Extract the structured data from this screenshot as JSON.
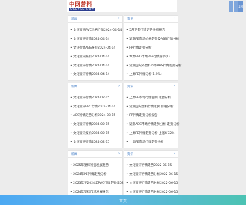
{
  "header": {
    "logo_cn": "中网营料",
    "logo_en": "ULEVLE.COM",
    "btn3_label": "1M"
  },
  "cards": [
    {
      "title": "新闻",
      "more": "›",
      "items": [
        "文化资讯PVC价格行情2024-04-14",
        "文化资讯行情2024-04-14",
        "文化行情ABS报价2024-04-14",
        "文化资讯报价2024-04-14",
        "文化资讯行情2024-04-14",
        "文化资讯行情2024-04-14"
      ]
    },
    {
      "title": "资讯",
      "more": "›",
      "items": [
        "5月下旬行情走势分析报告",
        "近期PE市场价格走势及ABS行情分析",
        "PP行情走势分析",
        "本周PVC市场PTA行情分析(1)",
        "近期国内外塑料市场ABS行情走势分析",
        "上周PE行情分析(1.2%)"
      ]
    },
    {
      "title": "新闻",
      "more": "›",
      "items": [
        "文化资讯行情2024-02-15",
        "文化资讯PVC行情2024-04-14",
        "ABS行情走势分析2024-03-15",
        "文化资讯行情2024-02-15",
        "文化资讯报价2024-02-15",
        "文化资讯行情2024-02-15"
      ]
    },
    {
      "title": "资讯",
      "more": "›",
      "items": [
        "上周PE市场行情回顾 走势分析",
        "近期国内塑料行情走势 价格分析",
        "PP行情走势分析报告",
        "近期ABS市场行情走势分析 走势分析",
        "上周PE行情走势分析 上涨4.72%",
        "上周PE市场行情走势分析"
      ]
    },
    {
      "title": "新闻",
      "more": "›",
      "items": [
        "2025年塑料行业发展趋势",
        "2024年PE行情走势分析",
        "2023年至2024年PVC行情走势(2023)",
        "2024年塑料市场发展报告"
      ]
    },
    {
      "title": "资讯",
      "more": "›",
      "items": [
        "文化资讯行情走势2022-05-15",
        "文化资讯行情走势分析2022-06-15",
        "文化资讯行情走势分析2022-06-15",
        "文化资讯行情走势分析2022-06-15"
      ]
    }
  ],
  "footer": {
    "label": "首页"
  }
}
